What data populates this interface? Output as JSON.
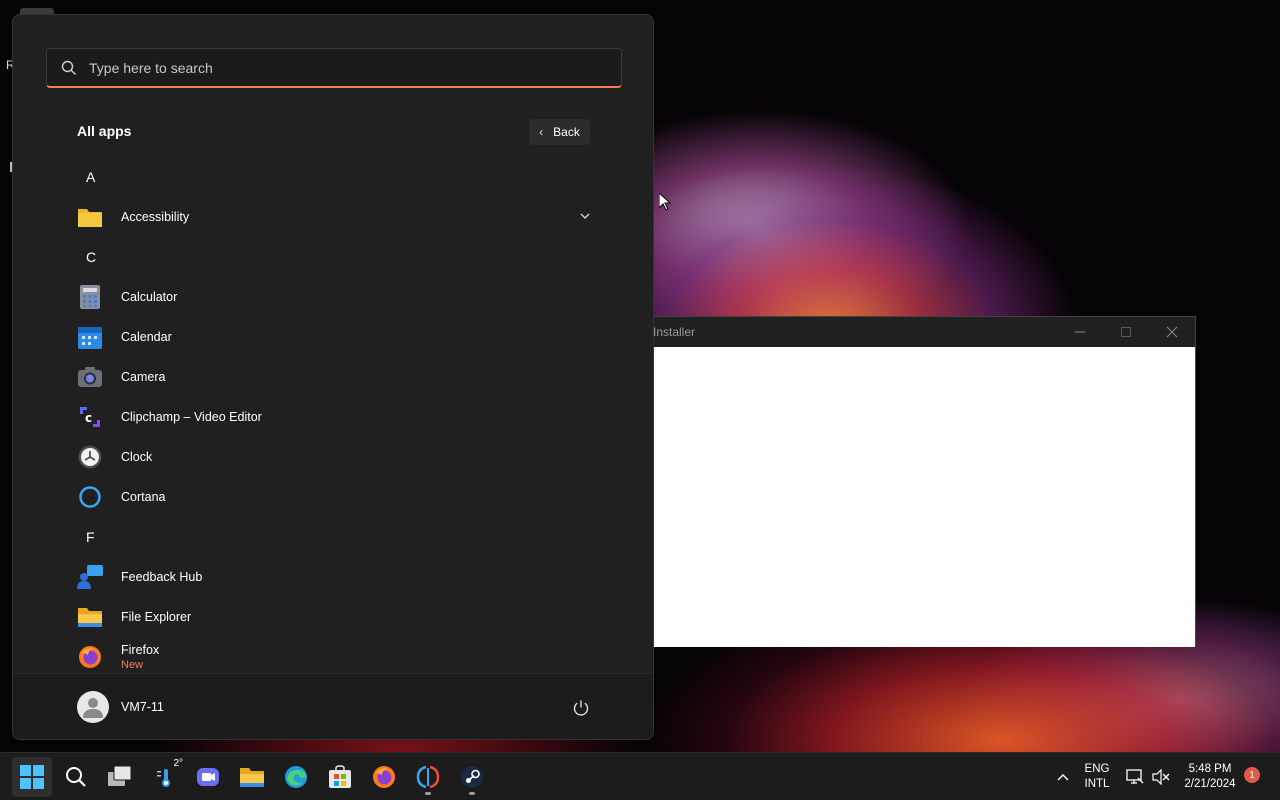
{
  "installer_window": {
    "title": "Installer",
    "controls": {
      "minimize": "—",
      "maximize": "☐",
      "close": "✕"
    }
  },
  "desktop": {
    "partial_label": "R"
  },
  "start_menu": {
    "search": {
      "placeholder": "Type here to search",
      "value": ""
    },
    "header": {
      "title": "All apps",
      "back_label": "Back"
    },
    "sections": [
      {
        "letter": "A",
        "apps": [
          {
            "label": "Accessibility",
            "icon": "folder-icon",
            "expandable": true
          }
        ]
      },
      {
        "letter": "C",
        "apps": [
          {
            "label": "Calculator",
            "icon": "calculator-icon"
          },
          {
            "label": "Calendar",
            "icon": "calendar-icon"
          },
          {
            "label": "Camera",
            "icon": "camera-icon"
          },
          {
            "label": "Clipchamp – Video Editor",
            "icon": "clipchamp-icon"
          },
          {
            "label": "Clock",
            "icon": "clock-icon"
          },
          {
            "label": "Cortana",
            "icon": "cortana-icon"
          }
        ]
      },
      {
        "letter": "F",
        "apps": [
          {
            "label": "Feedback Hub",
            "icon": "feedback-hub-icon"
          },
          {
            "label": "File Explorer",
            "icon": "file-explorer-icon"
          },
          {
            "label": "Firefox",
            "sub": "New",
            "icon": "firefox-icon"
          }
        ]
      }
    ],
    "footer": {
      "user_name": "VM7-11"
    }
  },
  "taskbar": {
    "items": [
      "start-icon",
      "search-icon",
      "task-view-icon",
      "weather-icon",
      "teams-chat-icon",
      "file-explorer-icon",
      "edge-icon",
      "microsoft-store-icon",
      "firefox-icon",
      "uninstaller-icon",
      "steam-icon"
    ],
    "weather_temp": "2°",
    "tray": {
      "lang_line1": "ENG",
      "lang_line2": "INTL",
      "time": "5:48 PM",
      "date": "2/21/2024",
      "notification_count": "1"
    }
  },
  "colors": {
    "accent": "#f07b5a",
    "start_bg": "#202020",
    "taskbar_bg": "#1c1c1c"
  }
}
